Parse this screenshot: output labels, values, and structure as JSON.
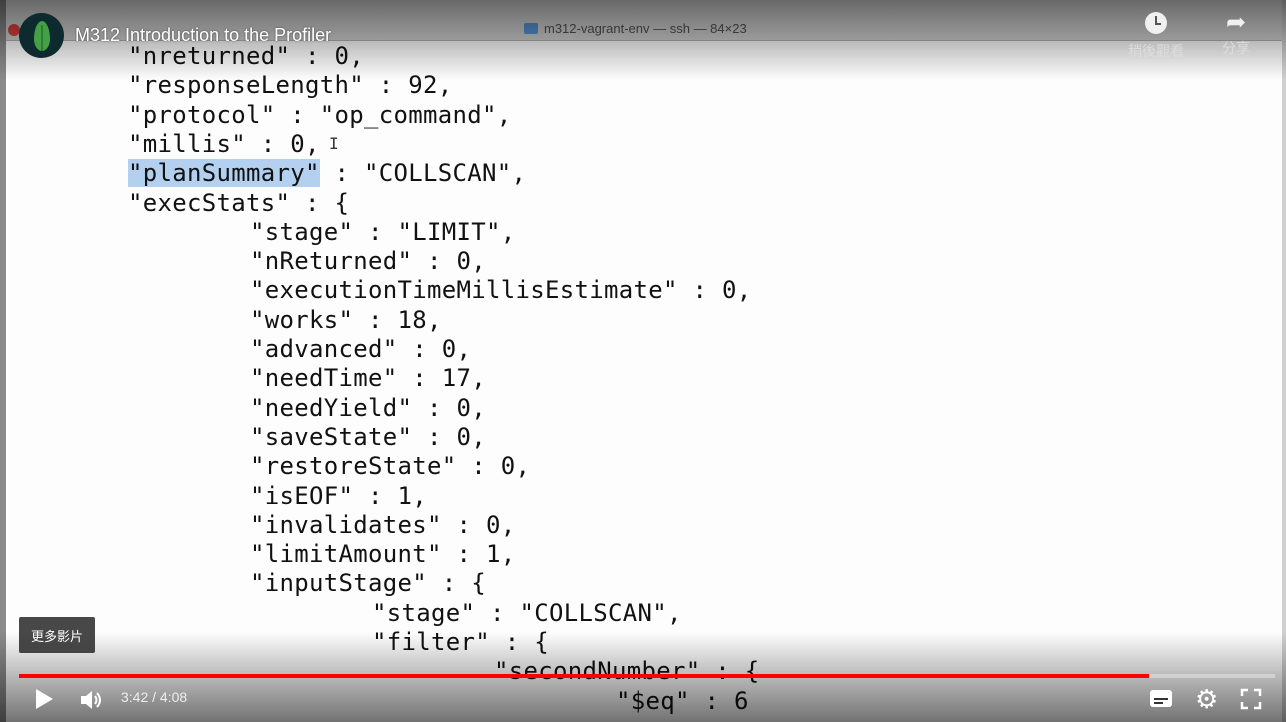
{
  "video": {
    "title": "M312 Introduction to the Profiler",
    "watch_later_label": "稍後觀看",
    "share_label": "分享",
    "more_videos_label": "更多影片",
    "time_display": "3:42 / 4:08",
    "progress_fraction": 0.9
  },
  "terminal": {
    "window_title": "m312-vagrant-env — ssh — 84×23"
  },
  "code_lines": [
    {
      "text": "\"nreturned\" : 0,",
      "indent": 0
    },
    {
      "text": "\"responseLength\" : 92,",
      "indent": 0
    },
    {
      "text": "\"protocol\" : \"op_command\",",
      "indent": 0
    },
    {
      "text": "\"millis\" : 0,",
      "indent": 0
    },
    {
      "text": "\"planSummary\" : \"COLLSCAN\",",
      "indent": 0,
      "highlight": "\"planSummary\""
    },
    {
      "text": "\"execStats\" : {",
      "indent": 0
    },
    {
      "text": "\"stage\" : \"LIMIT\",",
      "indent": 1
    },
    {
      "text": "\"nReturned\" : 0,",
      "indent": 1
    },
    {
      "text": "\"executionTimeMillisEstimate\" : 0,",
      "indent": 1
    },
    {
      "text": "\"works\" : 18,",
      "indent": 1
    },
    {
      "text": "\"advanced\" : 0,",
      "indent": 1
    },
    {
      "text": "\"needTime\" : 17,",
      "indent": 1
    },
    {
      "text": "\"needYield\" : 0,",
      "indent": 1
    },
    {
      "text": "\"saveState\" : 0,",
      "indent": 1
    },
    {
      "text": "\"restoreState\" : 0,",
      "indent": 1
    },
    {
      "text": "\"isEOF\" : 1,",
      "indent": 1
    },
    {
      "text": "\"invalidates\" : 0,",
      "indent": 1
    },
    {
      "text": "\"limitAmount\" : 1,",
      "indent": 1
    },
    {
      "text": "\"inputStage\" : {",
      "indent": 1
    },
    {
      "text": "\"stage\" : \"COLLSCAN\",",
      "indent": 2
    },
    {
      "text": "\"filter\" : {",
      "indent": 2
    },
    {
      "text": "\"secondNumber\" : {",
      "indent": 3
    },
    {
      "text": "\"$eq\" : 6",
      "indent": 4
    }
  ],
  "icons": {
    "watch_later": "clock-icon",
    "share": "share-icon",
    "play": "play-icon",
    "volume": "volume-icon",
    "subtitles": "subtitles-icon",
    "settings": "gear-icon",
    "fullscreen": "fullscreen-icon"
  },
  "colors": {
    "progress": "#ff0000",
    "selection_highlight": "#b4d0f0"
  }
}
